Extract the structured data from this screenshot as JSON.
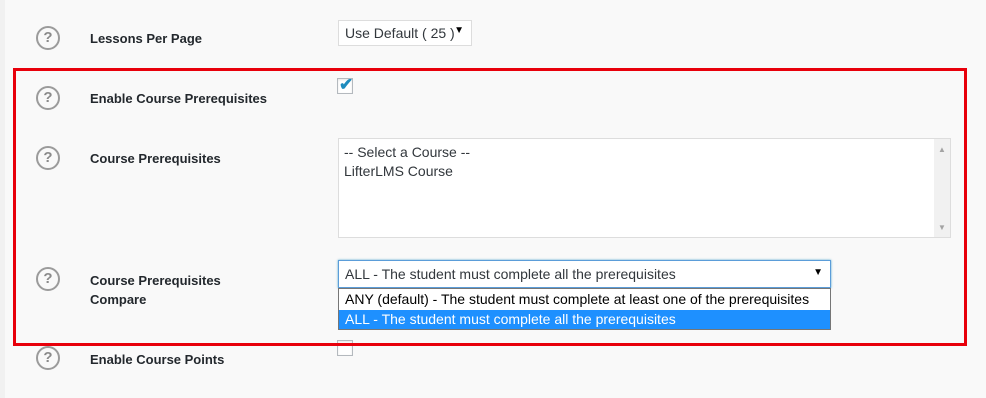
{
  "rows": {
    "lessons_per_page": {
      "label": "Lessons Per Page",
      "select_value": "Use Default ( 25 )"
    },
    "enable_prereq": {
      "label": "Enable Course Prerequisites",
      "checked": true
    },
    "course_prereq": {
      "label": "Course Prerequisites",
      "options": [
        "-- Select a Course --",
        "LifterLMS Course"
      ]
    },
    "prereq_compare": {
      "label_line1": "Course Prerequisites",
      "label_line2": "Compare",
      "selected_value": "ALL - The student must complete all the prerequisites",
      "options": [
        "ANY (default) - The student must complete at least one of the prerequisites",
        "ALL - The student must complete all the prerequisites"
      ]
    },
    "enable_points": {
      "label": "Enable Course Points",
      "checked": false
    }
  },
  "icons": {
    "help": "?",
    "dropdown_arrow": "▼",
    "check": "✔",
    "scroll_up": "▲",
    "scroll_down": "▼"
  },
  "colors": {
    "highlight": "#e8000b",
    "selected_option": "#1e90ff",
    "checkmark": "#1e8cbe"
  }
}
